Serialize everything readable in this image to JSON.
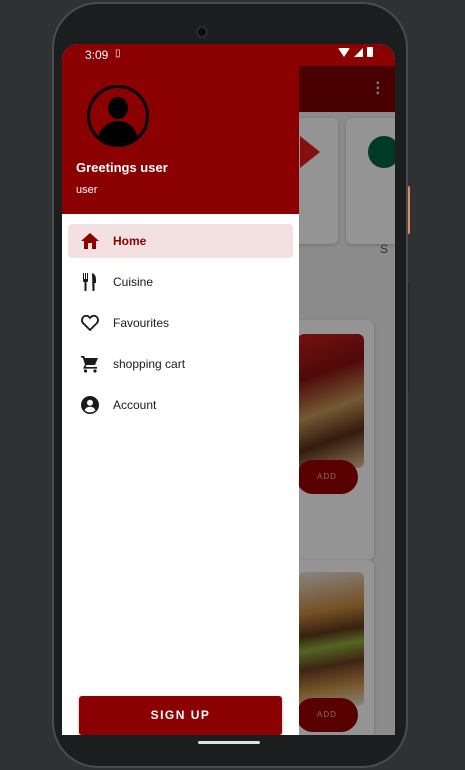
{
  "status_bar": {
    "time": "3:09",
    "sim_icon": "sim-card-icon"
  },
  "background": {
    "add_button_1": "ADD",
    "add_button_2": "ADD",
    "partial_text": "S"
  },
  "drawer": {
    "greeting": "Greetings user",
    "username": "user",
    "items": [
      {
        "label": "Home",
        "icon": "home-icon",
        "active": true
      },
      {
        "label": "Cuisine",
        "icon": "fork-knife-icon",
        "active": false
      },
      {
        "label": "Favourites",
        "icon": "heart-icon",
        "active": false
      },
      {
        "label": "shopping cart",
        "icon": "cart-icon",
        "active": false
      },
      {
        "label": "Account",
        "icon": "account-icon",
        "active": false
      }
    ],
    "signup_label": "SIGN UP"
  },
  "colors": {
    "primary": "#8b0000",
    "active_bg": "#f3e1e1"
  }
}
